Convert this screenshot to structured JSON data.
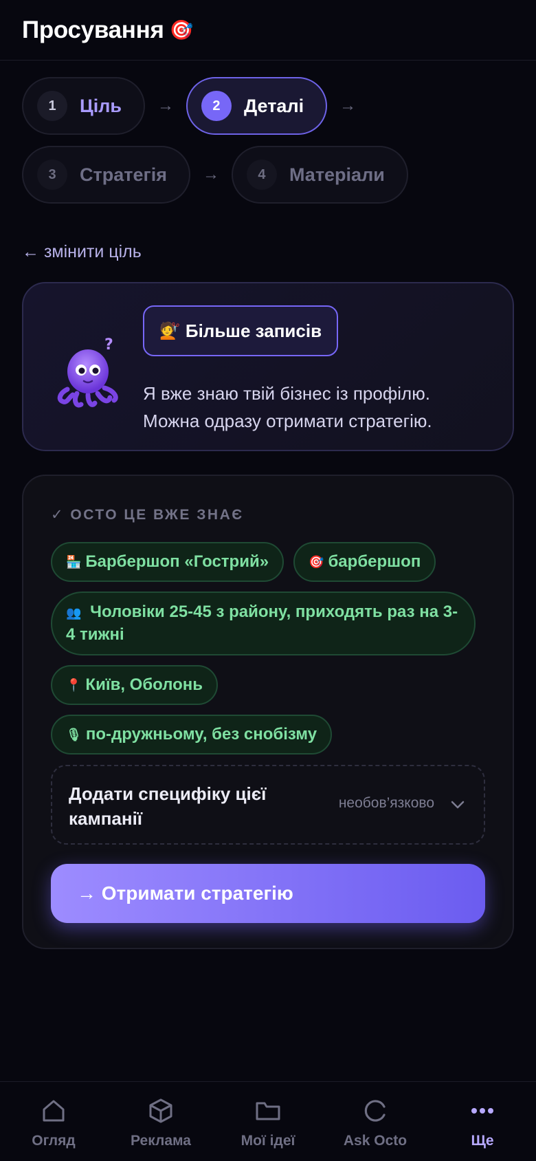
{
  "header": {
    "title": "Просування",
    "title_icon": "🎯"
  },
  "steps": [
    {
      "num": "1",
      "label": "Ціль",
      "state": "done"
    },
    {
      "num": "2",
      "label": "Деталі",
      "state": "active"
    },
    {
      "num": "3",
      "label": "Стратегія",
      "state": "todo"
    },
    {
      "num": "4",
      "label": "Матеріали",
      "state": "todo"
    }
  ],
  "back_link": "← змінити ціль",
  "intro": {
    "goal_icon": "💇",
    "goal_label": "Більше записів",
    "text_line1": "Я вже знаю твій бізнес із профілю.",
    "text_line2": "Можна одразу отримати стратегію."
  },
  "known": {
    "title": "✓ ОСТО ЦЕ ВЖЕ ЗНАЄ",
    "chips": [
      {
        "icon": "🏪",
        "text": "Барбершоп «Гострий»"
      },
      {
        "icon": "🎯",
        "text": "барбершоп"
      },
      {
        "icon": "👥",
        "text": "Чоловіки 25-45 з району, приходять раз на 3-4 тижні"
      },
      {
        "icon": "📍",
        "text": "Київ, Оболонь"
      },
      {
        "icon": "🎙",
        "text": "по-дружньому, без снобізму"
      }
    ]
  },
  "specifics": {
    "label": "Додати специфіку цієї кампанії",
    "optional": "необов’язково"
  },
  "cta_label": "→ Отримати стратегію",
  "nav": [
    {
      "label": "Огляд",
      "icon": "home-icon",
      "active": false
    },
    {
      "label": "Реклама",
      "icon": "cube-icon",
      "active": false
    },
    {
      "label": "Мої ідеї",
      "icon": "folder-icon",
      "active": false
    },
    {
      "label": "Ask Octo",
      "icon": "octo-circle-icon",
      "active": false
    },
    {
      "label": "Ще",
      "icon": "more-icon",
      "active": true
    }
  ],
  "colors": {
    "accent": "#7767f7",
    "chip_text": "#7fe0a2",
    "background": "#07070f"
  }
}
